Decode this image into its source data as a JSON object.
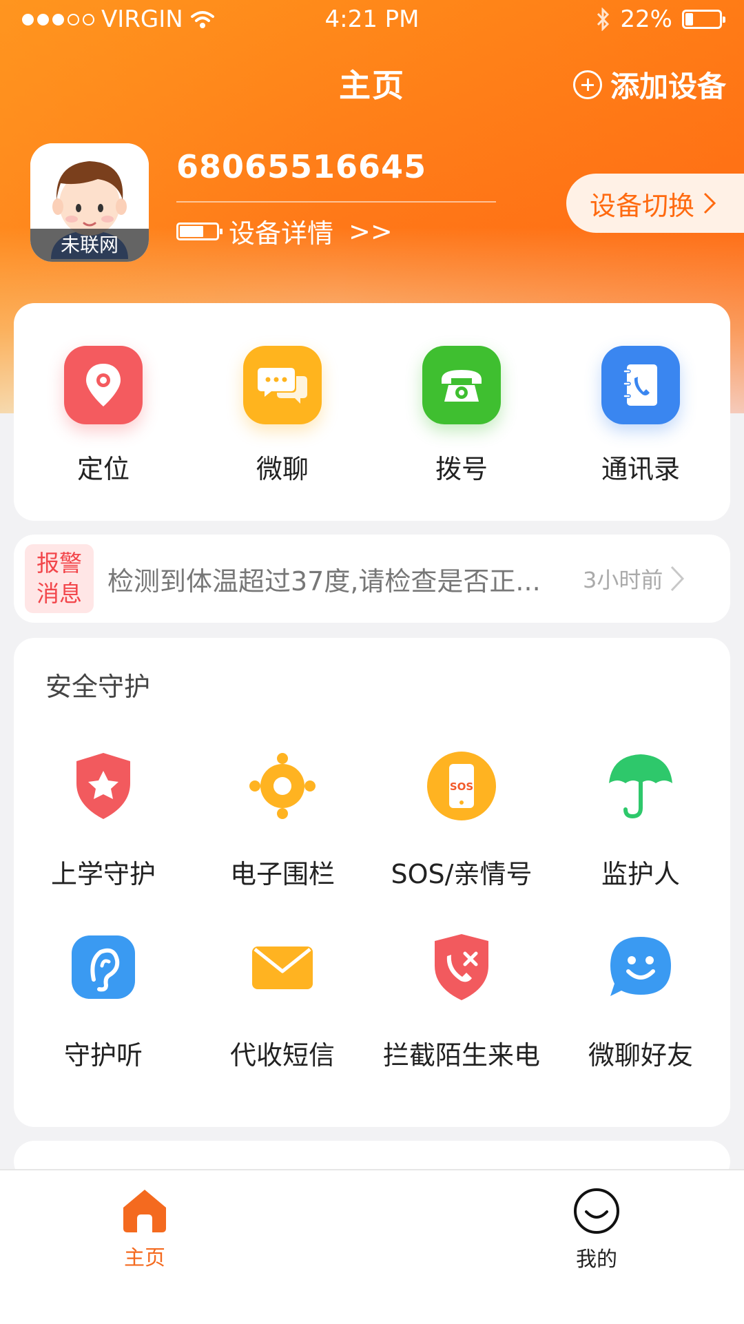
{
  "status_bar": {
    "carrier": "VIRGIN",
    "time": "4:21 PM",
    "battery_percent": "22%",
    "battery_level": 0.22,
    "signal_bars": 3,
    "icons": [
      "wifi-icon",
      "bluetooth-icon",
      "battery-icon"
    ]
  },
  "header": {
    "title": "主页",
    "add_device_label": "添加设备"
  },
  "device": {
    "avatar_status": "未联网",
    "number": "68065516645",
    "detail_label": "设备详情",
    "detail_arrow": ">>",
    "switch_label": "设备切换",
    "battery_level": 0.6
  },
  "quick_actions": [
    {
      "label": "定位",
      "icon": "location-pin-icon",
      "color": "#f45b5f"
    },
    {
      "label": "微聊",
      "icon": "chat-bubbles-icon",
      "color": "#ffb41e"
    },
    {
      "label": "拨号",
      "icon": "telephone-icon",
      "color": "#3fbf30"
    },
    {
      "label": "通讯录",
      "icon": "contact-book-icon",
      "color": "#3a86f0"
    }
  ],
  "alert": {
    "tag": "报警消息",
    "message": "检测到体温超过37度,请检查是否正...",
    "time": "3小时前"
  },
  "safety": {
    "title": "安全守护",
    "items": [
      {
        "label": "上学守护",
        "icon": "shield-star-icon"
      },
      {
        "label": "电子围栏",
        "icon": "fence-target-icon"
      },
      {
        "label": "SOS/亲情号",
        "icon": "sos-phone-icon"
      },
      {
        "label": "监护人",
        "icon": "umbrella-icon"
      },
      {
        "label": "守护听",
        "icon": "ear-icon"
      },
      {
        "label": "代收短信",
        "icon": "envelope-icon"
      },
      {
        "label": "拦截陌生来电",
        "icon": "call-block-shield-icon"
      },
      {
        "label": "微聊好友",
        "icon": "smiley-chat-icon"
      }
    ]
  },
  "tabbar": {
    "home_label": "主页",
    "mine_label": "我的",
    "active_color": "#f46a1f"
  }
}
